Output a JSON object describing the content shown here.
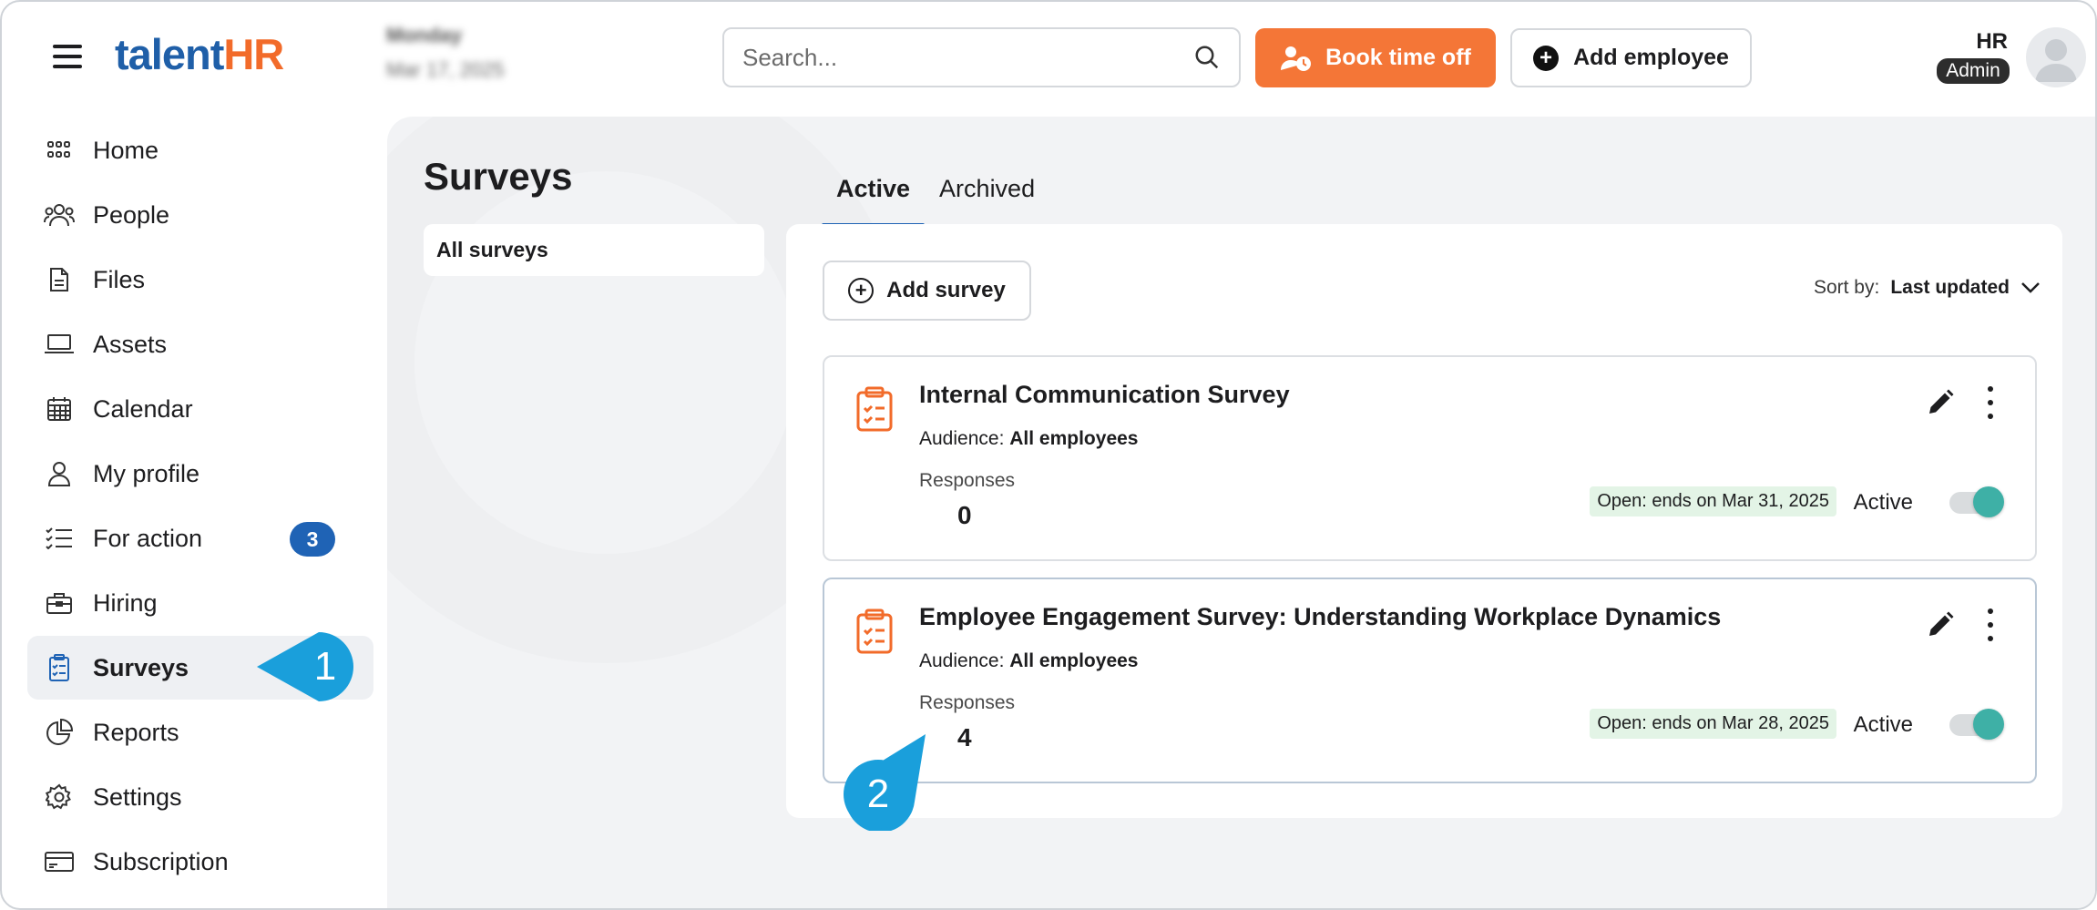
{
  "app": {
    "logo_part1": "talent",
    "logo_part2": "HR",
    "blurred_day": "Monday",
    "blurred_date": "Mar 17, 2025"
  },
  "header": {
    "search_placeholder": "Search...",
    "book_time_off_label": "Book time off",
    "add_employee_label": "Add employee",
    "user_name": "HR",
    "user_role": "Admin"
  },
  "sidebar": {
    "items": [
      {
        "label": "Home",
        "icon": "grid-icon"
      },
      {
        "label": "People",
        "icon": "people-icon"
      },
      {
        "label": "Files",
        "icon": "file-icon"
      },
      {
        "label": "Assets",
        "icon": "laptop-icon"
      },
      {
        "label": "Calendar",
        "icon": "calendar-icon"
      },
      {
        "label": "My profile",
        "icon": "person-icon"
      },
      {
        "label": "For action",
        "icon": "checklist-icon",
        "badge": "3"
      },
      {
        "label": "Hiring",
        "icon": "briefcase-icon"
      },
      {
        "label": "Surveys",
        "icon": "clipboard-icon",
        "active": true
      },
      {
        "label": "Reports",
        "icon": "pie-chart-icon"
      },
      {
        "label": "Settings",
        "icon": "gear-icon"
      },
      {
        "label": "Subscription",
        "icon": "credit-card-icon"
      }
    ]
  },
  "main": {
    "title": "Surveys",
    "subnav_label": "All surveys",
    "tabs": [
      {
        "label": "Active",
        "active": true
      },
      {
        "label": "Archived",
        "active": false
      }
    ],
    "add_survey_label": "Add survey",
    "sort_label": "Sort by:",
    "sort_value": "Last updated",
    "surveys": [
      {
        "title": "Internal Communication Survey",
        "audience_label": "Audience:",
        "audience_value": "All employees",
        "responses_label": "Responses",
        "responses": "0",
        "open_status": "Open: ends on Mar 31, 2025",
        "status_label": "Active"
      },
      {
        "title": "Employee Engagement Survey: Understanding Workplace Dynamics",
        "audience_label": "Audience:",
        "audience_value": "All employees",
        "responses_label": "Responses",
        "responses": "4",
        "open_status": "Open: ends on Mar 28, 2025",
        "status_label": "Active"
      }
    ]
  },
  "annotations": {
    "callout_1": "1",
    "callout_2": "2"
  },
  "colors": {
    "brand_blue": "#1f5fa8",
    "brand_orange": "#f26b2a",
    "book_button": "#f47637",
    "toggle_on": "#3eb0a6",
    "callout": "#1a9fdb",
    "badge_blue": "#1f63b5"
  }
}
